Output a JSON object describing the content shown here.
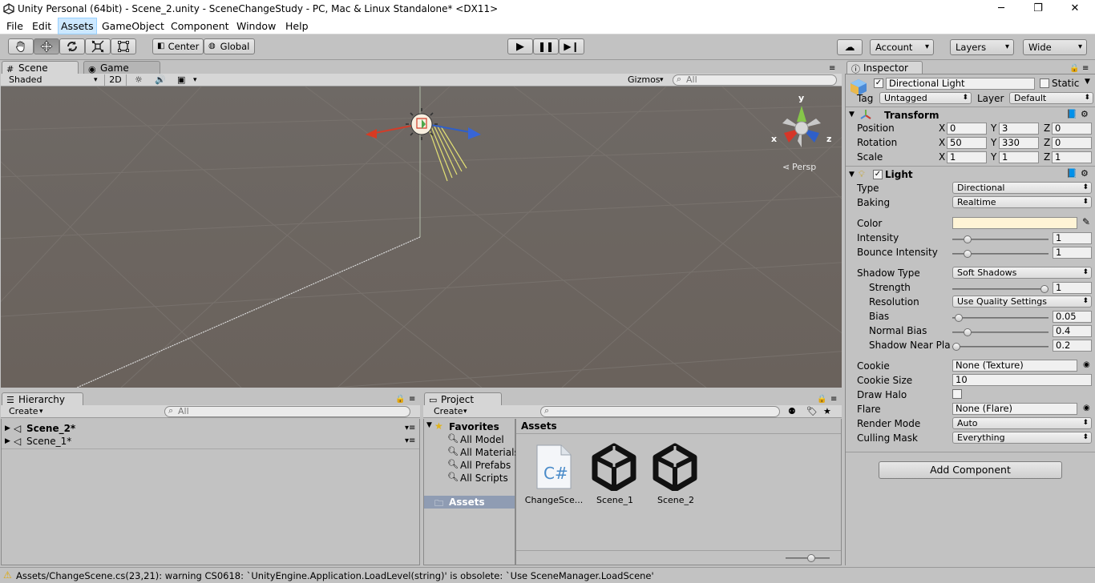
{
  "window": {
    "title": "Unity Personal (64bit) - Scene_2.unity - SceneChangeStudy - PC, Mac & Linux Standalone* <DX11>",
    "minimize": "─",
    "restore": "❐",
    "close": "✕"
  },
  "menu": [
    "File",
    "Edit",
    "Assets",
    "GameObject",
    "Component",
    "Window",
    "Help"
  ],
  "toolbar": {
    "pivot_label": "Center",
    "space_label": "Global",
    "account_label": "Account",
    "layers_label": "Layers",
    "layout_label": "Wide"
  },
  "scene_view": {
    "tab_scene": "Scene",
    "tab_game": "Game",
    "draw_mode": "Shaded",
    "mode_2d": "2D",
    "gizmos_label": "Gizmos",
    "search_placeholder": "All",
    "gizmo_y": "y",
    "gizmo_x": "x",
    "gizmo_z": "z",
    "persp_label": "Persp"
  },
  "hierarchy": {
    "tab": "Hierarchy",
    "create": "Create",
    "search_placeholder": "All",
    "items": [
      "Scene_2*",
      "Scene_1*"
    ]
  },
  "project": {
    "tab": "Project",
    "create": "Create",
    "favorites_label": "Favorites",
    "favorites": [
      "All Model",
      "All Materials",
      "All Prefabs",
      "All Scripts"
    ],
    "assets_folder": "Assets",
    "breadcrumb": "Assets",
    "assets": [
      "ChangeSce...",
      "Scene_1",
      "Scene_2"
    ]
  },
  "inspector": {
    "tab": "Inspector",
    "object_name": "Directional Light",
    "static_label": "Static",
    "tag_label": "Tag",
    "tag_value": "Untagged",
    "layer_label": "Layer",
    "layer_value": "Default",
    "transform": {
      "title": "Transform",
      "rows": [
        {
          "label": "Position",
          "x": "0",
          "y": "3",
          "z": "0"
        },
        {
          "label": "Rotation",
          "x": "50",
          "y": "330",
          "z": "0"
        },
        {
          "label": "Scale",
          "x": "1",
          "y": "1",
          "z": "1"
        }
      ]
    },
    "axis_x": "X",
    "axis_y": "Y",
    "axis_z": "Z",
    "light": {
      "title": "Light",
      "type_label": "Type",
      "type_value": "Directional",
      "baking_label": "Baking",
      "baking_value": "Realtime",
      "color_label": "Color",
      "color_value": "#fff4d6",
      "intensity_label": "Intensity",
      "intensity_value": "1",
      "intensity_fraction": 0.125,
      "bounce_label": "Bounce Intensity",
      "bounce_value": "1",
      "bounce_fraction": 0.125,
      "shadow_type_label": "Shadow Type",
      "shadow_type_value": "Soft Shadows",
      "strength_label": "Strength",
      "strength_value": "1",
      "strength_fraction": 1.0,
      "resolution_label": "Resolution",
      "resolution_value": "Use Quality Settings",
      "bias_label": "Bias",
      "bias_value": "0.05",
      "bias_fraction": 0.025,
      "normal_bias_label": "Normal Bias",
      "normal_bias_value": "0.4",
      "normal_bias_fraction": 0.13,
      "near_plane_label": "Shadow Near Plan",
      "near_plane_value": "0.2",
      "near_plane_fraction": 0.0,
      "cookie_label": "Cookie",
      "cookie_value": "None (Texture)",
      "cookie_size_label": "Cookie Size",
      "cookie_size_value": "10",
      "draw_halo_label": "Draw Halo",
      "flare_label": "Flare",
      "flare_value": "None (Flare)",
      "render_mode_label": "Render Mode",
      "render_mode_value": "Auto",
      "culling_mask_label": "Culling Mask",
      "culling_mask_value": "Everything"
    },
    "add_component": "Add Component"
  },
  "status": {
    "message": "Assets/ChangeScene.cs(23,21): warning CS0618: `UnityEngine.Application.LoadLevel(string)' is obsolete: `Use SceneManager.LoadScene'"
  }
}
